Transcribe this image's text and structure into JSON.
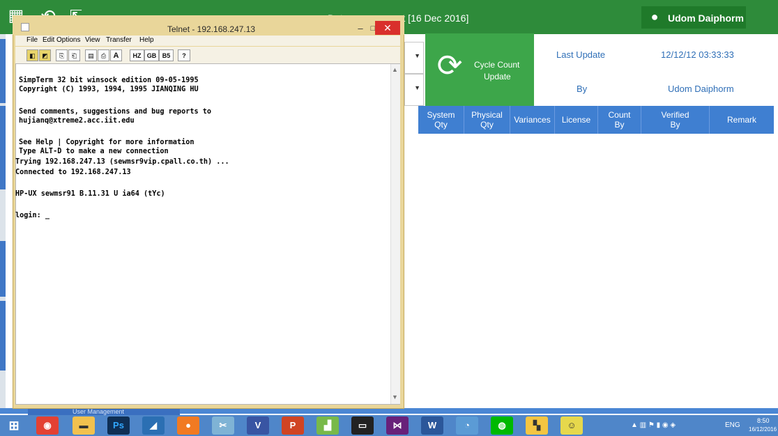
{
  "background_app": {
    "title": "Datamanagement [16 Dec 2016]",
    "user_name": "Udom Daiphorm",
    "cycle_button": {
      "line1": "Cycle Count",
      "line2": "Update"
    },
    "last_update_label": "Last Update",
    "last_update_value": "12/12/12  03:33:33",
    "by_label": "By",
    "by_value": "Udom Daiphorm",
    "columns": [
      {
        "line1": "System",
        "line2": "Qty"
      },
      {
        "line1": "Physical",
        "line2": "Qty"
      },
      {
        "line1": "Variances",
        "line2": ""
      },
      {
        "line1": "License",
        "line2": ""
      },
      {
        "line1": "Count",
        "line2": "By"
      },
      {
        "line1": "Verified",
        "line2": "By"
      },
      {
        "line1": "Remark",
        "line2": ""
      }
    ],
    "bottom_tab": "User Management"
  },
  "telnet": {
    "title": "Telnet - 192.168.247.13",
    "menu": [
      "File",
      "Edit",
      "Options",
      "View",
      "Transfer",
      "Help"
    ],
    "toolbar": [
      "A",
      "HZ",
      "GB",
      "B5",
      "?"
    ],
    "lines": [
      "SimpTerm 32 bit winsock edition 09-05-1995",
      "Copyright (C) 1993, 1994, 1995 JIANQING HU",
      "",
      "Send comments, suggestions and bug reports to",
      "hujianq@xtreme2.acc.iit.edu",
      "",
      "See Help | Copyright for more information",
      "Type ALT-D to make a new connection",
      "Trying 192.168.247.13 (sewmsr9vip.cpall.co.th) ...",
      "Connected to 192.168.247.13",
      "",
      "HP-UX sewmsr91 B.11.31 U ia64 (tYc)",
      "",
      "login: _"
    ]
  },
  "taskbar": {
    "apps": [
      "start",
      "chrome",
      "file-explorer",
      "photoshop",
      "app",
      "orange-app",
      "paint-tool",
      "visio",
      "powerpoint",
      "chart-app",
      "cmd",
      "visual-studio",
      "word",
      "paint",
      "line",
      "windows-explorer",
      "game"
    ],
    "tray": "ENG",
    "time": "8:50",
    "date": "16/12/2016"
  },
  "colors": {
    "green": "#2e8b3a",
    "blue_header": "#3f7fd1",
    "telnet_frame": "#e9d69a",
    "close_red": "#d9302c"
  }
}
